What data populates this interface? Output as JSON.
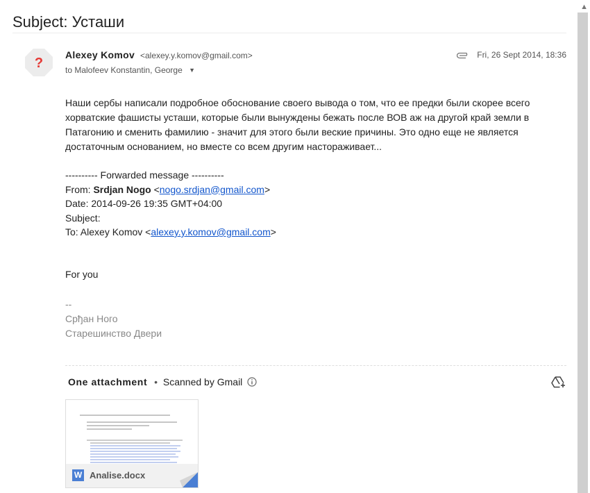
{
  "subject": "Subject: Усташи",
  "sender": {
    "name": "Alexey Komov",
    "email": "<alexey.y.komov@gmail.com>",
    "avatar_glyph": "?",
    "avatar_color": "#ef5350"
  },
  "recipients": "to Malofeev Konstantin, George",
  "date": "Fri, 26 Sept 2014, 18:36",
  "body_paragraph": [
    "Наши сербы написали подробное обоснование своего вывода о том, что ее предки были скорее всего",
    "хорватские фашисты усташи, которые были вынуждены бежать после ВОВ аж на другой край земли в",
    "Патагонию и сменить фамилию - значит для этого были веские причины. Это одно еще не является",
    "достаточным основанием, но вместе со всем другим настораживает..."
  ],
  "forwarded": {
    "header": "---------- Forwarded message ----------",
    "from_label": "From: ",
    "from_name": "Srdjan Nogo",
    "from_email": "nogo.srdjan@gmail.com",
    "date_line": "Date: 2014-09-26 19:35 GMT+04:00",
    "subject_line": "Subject:",
    "to_label": "To: Alexey Komov <",
    "to_email": "alexey.y.komov@gmail.com",
    "lt": "<",
    "gt": ">"
  },
  "for_you": "For you",
  "signature": {
    "dashes": "--",
    "line1": "Срђан Ного",
    "line2": "Старешинство Двери"
  },
  "attachments": {
    "title": "One attachment",
    "separator": "•",
    "scanned": "Scanned by Gmail",
    "file_name": "Analise.docx",
    "file_icon_letter": "W"
  },
  "icons": {
    "clip": "paperclip-icon",
    "info": "info-icon",
    "drive": "add-to-drive-icon",
    "caret": "chevron-down-icon"
  }
}
